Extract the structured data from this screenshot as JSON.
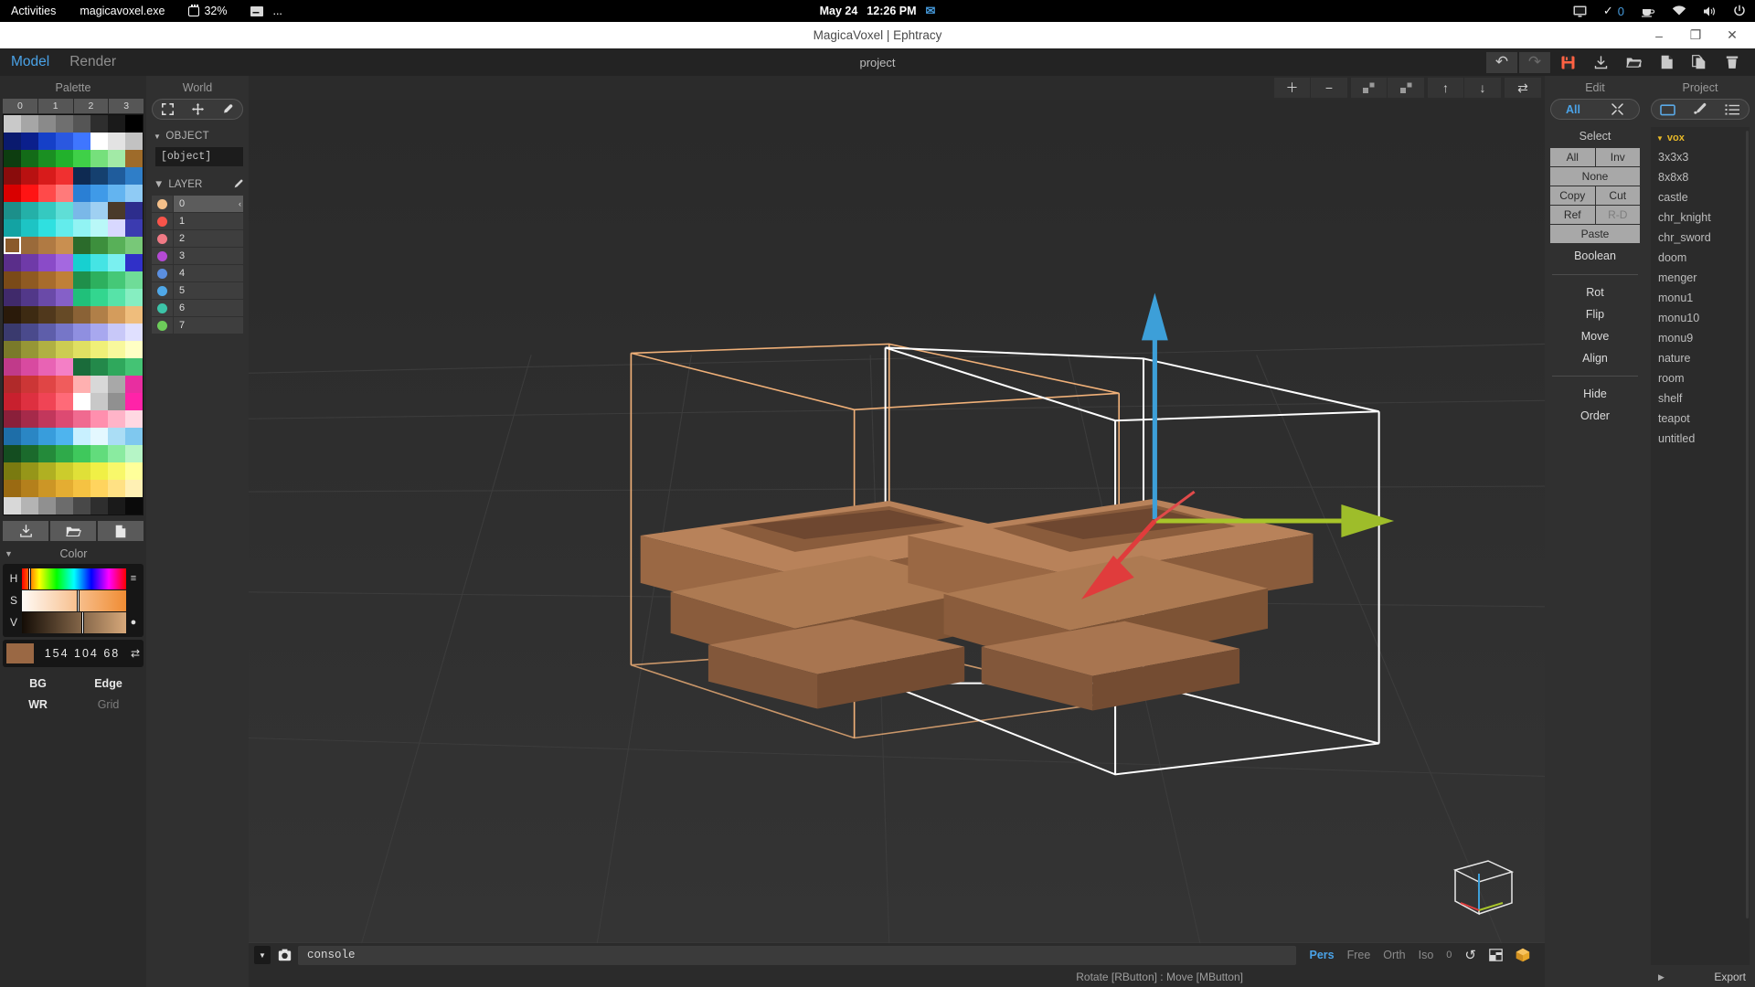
{
  "gnome_bar": {
    "activities": "Activities",
    "app_name": "magicavoxel.exe",
    "cpu_percent": "32%",
    "ellipsis": "...",
    "date": "May 24",
    "time": "12:26 PM",
    "mail_icon": "mail-icon",
    "screen_icon": "display-icon",
    "check_icon": "check-icon",
    "notification_count": "0",
    "coffee_icon": "coffee-icon",
    "wifi_icon": "wifi-icon",
    "volume_icon": "volume-icon",
    "power_icon": "power-icon"
  },
  "titlebar": {
    "title": "MagicaVoxel | Ephtracy",
    "minimize": "–",
    "maximize": "❐",
    "close": "✕"
  },
  "menubar": {
    "items": [
      {
        "label": "Model",
        "active": true
      },
      {
        "label": "Render",
        "active": false
      }
    ],
    "project_title": "project",
    "tools": [
      {
        "name": "undo-icon",
        "glyph": "↶",
        "boxed": true,
        "dim": false
      },
      {
        "name": "redo-icon",
        "glyph": "↷",
        "boxed": true,
        "dim": true
      },
      {
        "name": "save-icon",
        "glyph": "save",
        "boxed": false,
        "dim": false
      },
      {
        "name": "import-icon",
        "glyph": "⤓",
        "boxed": false,
        "dim": false
      },
      {
        "name": "open-folder-icon",
        "glyph": "folder",
        "boxed": false,
        "dim": false
      },
      {
        "name": "new-file-icon",
        "glyph": "file",
        "boxed": false,
        "dim": false
      },
      {
        "name": "copy-file-icon",
        "glyph": "copy",
        "boxed": false,
        "dim": false
      },
      {
        "name": "delete-icon",
        "glyph": "trash",
        "boxed": false,
        "dim": false
      }
    ],
    "accent_color": "#4aa3e8",
    "save_color": "#ff6243"
  },
  "palette": {
    "title": "Palette",
    "column_labels": [
      "0",
      "1",
      "2",
      "3"
    ],
    "selected_index": 56,
    "colors": [
      "#c9c9c9",
      "#a6a6a6",
      "#8a8a8a",
      "#6f6f6f",
      "#555555",
      "#2e2e2e",
      "#1a1a1a",
      "#000000",
      "#0a1a6e",
      "#0b1f8c",
      "#1540c8",
      "#2a58e0",
      "#3f76ff",
      "#ffffff",
      "#e3e3e3",
      "#c2c2c2",
      "#0d3d10",
      "#136b18",
      "#1a8f22",
      "#22b12c",
      "#3fd048",
      "#76e07c",
      "#a2eaa6",
      "#9e6b2a",
      "#8a0c0c",
      "#b81111",
      "#d81b1b",
      "#f03030",
      "#0e2a52",
      "#15406f",
      "#1f5c9c",
      "#2f7ec8",
      "#d90000",
      "#ff1414",
      "#ff4a4a",
      "#ff7a7a",
      "#2a7fd4",
      "#3f9ae8",
      "#63b4f0",
      "#8fcbf5",
      "#1c8f8a",
      "#24b0a8",
      "#35c9c0",
      "#5fded6",
      "#7ab8e8",
      "#9fd0f2",
      "#4a3a2a",
      "#2d2d8c",
      "#13a3a3",
      "#1dc4c4",
      "#2fe0e0",
      "#63ecec",
      "#91f3f3",
      "#b9f8f8",
      "#d8d8ff",
      "#3b3bb0",
      "#8a5a2b",
      "#9a6a3a",
      "#b07a43",
      "#c98f50",
      "#2b6b2b",
      "#3d8f3d",
      "#58b058",
      "#78c878",
      "#5a2e8a",
      "#6f3aa8",
      "#8a4bc8",
      "#a468e0",
      "#17d0d0",
      "#45e4e4",
      "#7af0f0",
      "#3030c8",
      "#7a4a18",
      "#8f5a22",
      "#a86c2c",
      "#c08038",
      "#1f8f4a",
      "#2db05e",
      "#45c877",
      "#6fdc98",
      "#402a6b",
      "#523889",
      "#6a4aa8",
      "#8560c8",
      "#20c07a",
      "#33d68f",
      "#57e3a8",
      "#86eec1",
      "#2a1a0a",
      "#3d2a12",
      "#50381c",
      "#664a26",
      "#8a6236",
      "#b07f48",
      "#d49c5c",
      "#efbd7c",
      "#3a3a6e",
      "#4a4a8c",
      "#5e5eaa",
      "#7676c8",
      "#8f8fe0",
      "#a8a8ef",
      "#c8c8f8",
      "#e0e0ff",
      "#7a7a2a",
      "#969636",
      "#b0b043",
      "#cccc52",
      "#e0e062",
      "#f0f078",
      "#f8f89c",
      "#ffffc4",
      "#c03a8a",
      "#d84aa0",
      "#e863b4",
      "#f47fc6",
      "#1a6b3a",
      "#23894a",
      "#2fa85c",
      "#44c374",
      "#b02a2a",
      "#cc3636",
      "#e04545",
      "#f05c5c",
      "#ffb0b0",
      "#d8d8d8",
      "#a8a8a8",
      "#e82ea0",
      "#c8202e",
      "#de3040",
      "#f04455",
      "#ff6a78",
      "#ffffff",
      "#c8c8c8",
      "#909090",
      "#ff23a8",
      "#8a1f3a",
      "#a62a4a",
      "#c2375c",
      "#dd4a72",
      "#f06a90",
      "#ff8fae",
      "#ffb4c8",
      "#ffd8e2",
      "#1e6ea8",
      "#2a86c4",
      "#389ddc",
      "#4eb4ee",
      "#c8f0ff",
      "#e4f8ff",
      "#aaddf5",
      "#7fc8ef",
      "#144d20",
      "#1b6a2c",
      "#248a3a",
      "#2faa4a",
      "#3fc85c",
      "#62dc7c",
      "#8aeba0",
      "#b6f5c6",
      "#7a7a10",
      "#969619",
      "#b0b022",
      "#cccc2c",
      "#e0e038",
      "#f0f046",
      "#f8f86a",
      "#ffff9a",
      "#9a6a12",
      "#b4801c",
      "#cc9626",
      "#e4ad32",
      "#f5c242",
      "#ffd45e",
      "#ffe184",
      "#fff0b4",
      "#d8d8d8",
      "#b4b4b4",
      "#909090",
      "#6c6c6c",
      "#484848",
      "#2e2e2e",
      "#1a1a1a",
      "#0a0a0a"
    ],
    "buttons": [
      {
        "name": "palette-save-button",
        "glyph": "⤓"
      },
      {
        "name": "palette-open-button",
        "glyph": "folder"
      },
      {
        "name": "palette-new-button",
        "glyph": "file"
      }
    ]
  },
  "color_panel": {
    "title": "Color",
    "collapse_arrow": "▼",
    "channels": [
      {
        "label": "H",
        "tail": "≡"
      },
      {
        "label": "S",
        "tail": ""
      },
      {
        "label": "V",
        "tail": "●"
      }
    ],
    "swatch_hex": "#9a6844",
    "rgb_text": "154 104 68",
    "swap_icon": "⇄",
    "toggles": [
      {
        "label": "BG",
        "dim": false
      },
      {
        "label": "Edge",
        "dim": false
      },
      {
        "label": "WR",
        "dim": false
      },
      {
        "label": "Grid",
        "dim": true
      }
    ]
  },
  "world_panel": {
    "title": "World",
    "tools": [
      {
        "name": "frame-selection-icon",
        "glyph": "⬚"
      },
      {
        "name": "move-tool-icon",
        "glyph": "✥"
      },
      {
        "name": "eyedropper-icon",
        "glyph": "✐"
      }
    ],
    "object_section": {
      "label": "OBJECT",
      "tri": "▼",
      "name": "[object]"
    },
    "layer_section": {
      "label": "LAYER",
      "tri": "▼",
      "pen_icon": "pencil-icon",
      "layers": [
        {
          "id": "0",
          "color": "#f5c08a",
          "selected": true,
          "chevron": "‹"
        },
        {
          "id": "1",
          "color": "#f9544a",
          "selected": false,
          "chevron": ""
        },
        {
          "id": "2",
          "color": "#f07a85",
          "selected": false,
          "chevron": ""
        },
        {
          "id": "3",
          "color": "#b44ad4",
          "selected": false,
          "chevron": ""
        },
        {
          "id": "4",
          "color": "#5b8fe0",
          "selected": false,
          "chevron": ""
        },
        {
          "id": "5",
          "color": "#4fa8e8",
          "selected": false,
          "chevron": ""
        },
        {
          "id": "6",
          "color": "#3cc4a8",
          "selected": false,
          "chevron": ""
        },
        {
          "id": "7",
          "color": "#6dcc5a",
          "selected": false,
          "chevron": ""
        }
      ]
    }
  },
  "viewport": {
    "toolbar_groups": [
      [
        {
          "name": "add-voxel-icon",
          "glyph": "＋"
        },
        {
          "name": "subtract-voxel-icon",
          "glyph": "−"
        }
      ],
      [
        {
          "name": "group-icon",
          "glyph": "group"
        },
        {
          "name": "ungroup-icon",
          "glyph": "ungroup"
        }
      ],
      [
        {
          "name": "move-up-icon",
          "glyph": "↑"
        },
        {
          "name": "move-down-icon",
          "glyph": "↓"
        }
      ],
      [
        {
          "name": "swap-icon",
          "glyph": "⇄"
        }
      ]
    ],
    "console_dropdown_icon": "▼",
    "camera-icon": "camera-icon",
    "console_value": "console",
    "camera_modes": [
      {
        "label": "Pers",
        "active": true
      },
      {
        "label": "Free",
        "active": false
      },
      {
        "label": "Orth",
        "active": false
      },
      {
        "label": "Iso",
        "active": false
      },
      {
        "label": "0",
        "active": false
      }
    ],
    "camera_icons": [
      {
        "name": "rotate-camera-icon",
        "glyph": "↺"
      },
      {
        "name": "grid-view-icon",
        "glyph": "grid"
      },
      {
        "name": "shading-cube-icon",
        "glyph": "cube"
      }
    ],
    "hint": "Rotate [RButton] : Move [MButton]"
  },
  "edit_panel": {
    "title": "Edit",
    "toggle": [
      {
        "label": "All",
        "active": true
      },
      {
        "label": "expand-icon",
        "active": false
      }
    ],
    "select_label": "Select",
    "select_buttons_row1": [
      {
        "label": "All",
        "dim": false
      },
      {
        "label": "Inv",
        "dim": false
      }
    ],
    "select_none": {
      "label": "None",
      "dim": false
    },
    "select_buttons_row2": [
      {
        "label": "Copy",
        "dim": false
      },
      {
        "label": "Cut",
        "dim": false
      }
    ],
    "select_buttons_row3": [
      {
        "label": "Ref",
        "dim": false
      },
      {
        "label": "R-D",
        "dim": true
      }
    ],
    "paste": {
      "label": "Paste",
      "dim": false
    },
    "boolean_label": "Boolean",
    "transform_items": [
      "Rot",
      "Flip",
      "Move",
      "Align"
    ],
    "display_items": [
      "Hide",
      "Order"
    ]
  },
  "project_panel": {
    "title": "Project",
    "tabs": [
      {
        "name": "folder-tab-icon",
        "active": true
      },
      {
        "name": "brush-tab-icon",
        "active": false
      },
      {
        "name": "list-tab-icon",
        "active": false
      }
    ],
    "group_label": "vox",
    "group_tri": "▼",
    "group_color": "#e8b928",
    "items": [
      "3x3x3",
      "8x8x8",
      "castle",
      "chr_knight",
      "chr_sword",
      "doom",
      "menger",
      "monu1",
      "monu10",
      "monu9",
      "nature",
      "room",
      "shelf",
      "teapot",
      "untitled"
    ],
    "footer": {
      "tri": "▶",
      "export_label": "Export"
    }
  }
}
